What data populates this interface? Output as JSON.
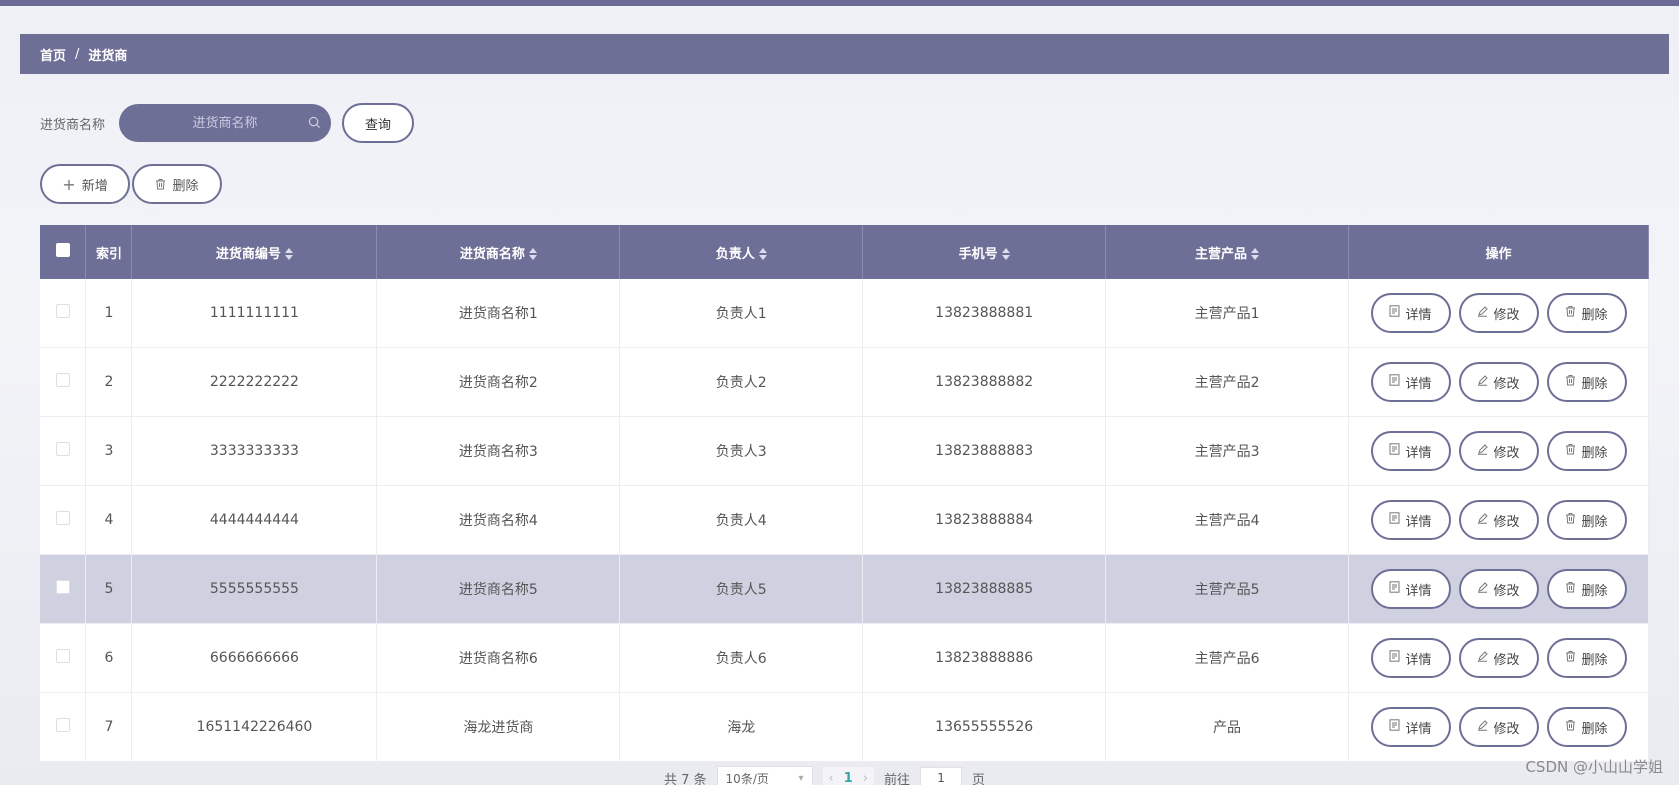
{
  "breadcrumb": {
    "home": "首页",
    "separator": "/",
    "current": "进货商"
  },
  "search": {
    "label": "进货商名称",
    "placeholder": "进货商名称",
    "query_button": "查询"
  },
  "actions": {
    "add": "新增",
    "delete": "删除"
  },
  "table": {
    "columns": [
      "索引",
      "进货商编号",
      "进货商名称",
      "负责人",
      "手机号",
      "主营产品",
      "操作"
    ],
    "rows": [
      {
        "index": "1",
        "code": "1111111111",
        "name": "进货商名称1",
        "person": "负责人1",
        "phone": "13823888881",
        "product": "主营产品1"
      },
      {
        "index": "2",
        "code": "2222222222",
        "name": "进货商名称2",
        "person": "负责人2",
        "phone": "13823888882",
        "product": "主营产品2"
      },
      {
        "index": "3",
        "code": "3333333333",
        "name": "进货商名称3",
        "person": "负责人3",
        "phone": "13823888883",
        "product": "主营产品3"
      },
      {
        "index": "4",
        "code": "4444444444",
        "name": "进货商名称4",
        "person": "负责人4",
        "phone": "13823888884",
        "product": "主营产品4"
      },
      {
        "index": "5",
        "code": "5555555555",
        "name": "进货商名称5",
        "person": "负责人5",
        "phone": "13823888885",
        "product": "主营产品5"
      },
      {
        "index": "6",
        "code": "6666666666",
        "name": "进货商名称6",
        "person": "负责人6",
        "phone": "13823888886",
        "product": "主营产品6"
      },
      {
        "index": "7",
        "code": "1651142226460",
        "name": "海龙进货商",
        "person": "海龙",
        "phone": "13655555526",
        "product": "产品"
      }
    ],
    "row_actions": {
      "detail": "详情",
      "edit": "修改",
      "delete": "删除"
    }
  },
  "pagination": {
    "total": "共 7 条",
    "page_size": "10条/页",
    "current_page": "1",
    "goto_label": "前往",
    "goto_value": "1",
    "page_unit": "页"
  },
  "watermark": "CSDN @小山山学姐",
  "colors": {
    "accent": "#6e6f97",
    "highlight_row": "#d0d1e0",
    "page_active": "#33a7a7"
  }
}
